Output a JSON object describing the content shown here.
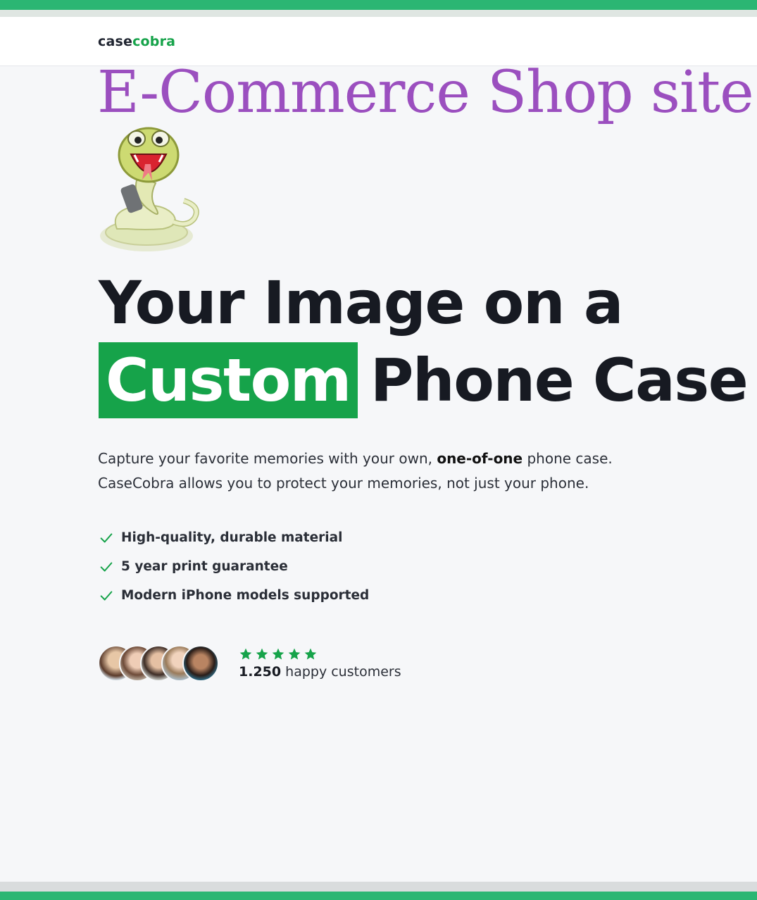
{
  "navbar": {
    "logo_part1": "case",
    "logo_part2": "cobra"
  },
  "overlay_title": "E-Commerce Shop site",
  "hero": {
    "headline_line1": "Your Image on a",
    "headline_highlight": "Custom",
    "headline_rest": "Phone Case",
    "description_before": "Capture your favorite memories with your own, ",
    "description_bold": "one-of-one",
    "description_after": " phone case.",
    "description_line2": "CaseCobra allows you to protect your memories, not just your phone."
  },
  "features": [
    "High-quality, durable material",
    "5 year print guarantee",
    "Modern iPhone models supported"
  ],
  "social_proof": {
    "rating_stars": 5,
    "customer_count": "1.250",
    "customer_label": " happy customers"
  },
  "colors": {
    "brand_green": "#16a34a",
    "accent_bar": "#2bb673",
    "overlay_purple": "#9b4fbf",
    "star_green": "#16a34a"
  },
  "icons": {
    "check": "check-icon",
    "star": "star-icon",
    "mascot": "snake-mascot"
  }
}
